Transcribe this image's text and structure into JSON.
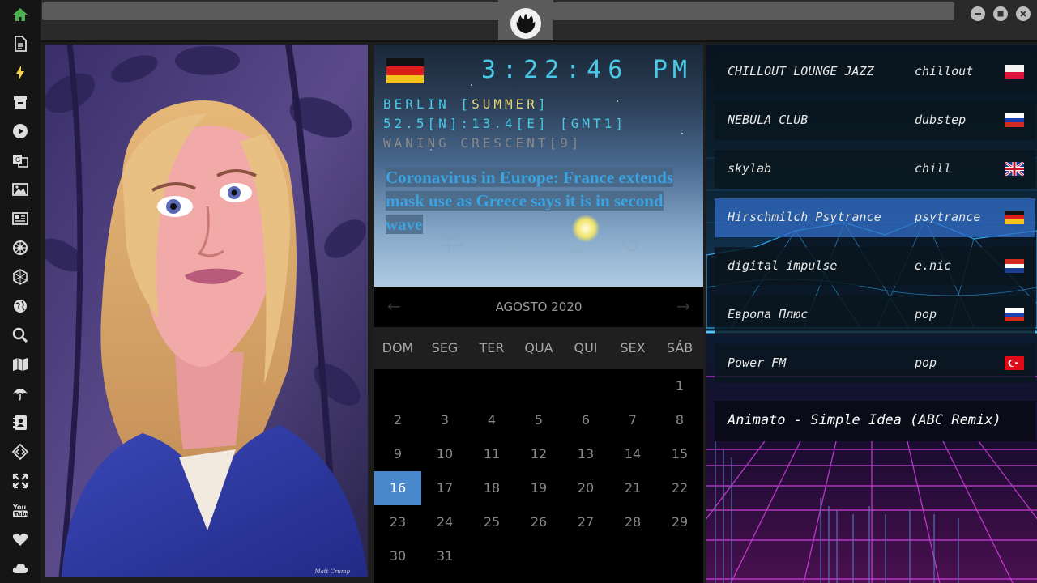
{
  "sidebar": {
    "icons": [
      "home-icon",
      "document-icon",
      "lightning-icon",
      "archive-icon",
      "play-icon",
      "translate-icon",
      "image-icon",
      "news-icon",
      "rebel-icon",
      "empire-icon",
      "globe-icon",
      "search-icon",
      "map-icon",
      "umbrella-icon",
      "contact-card-icon",
      "code-icon",
      "expand-icon",
      "youtube-icon",
      "heart-icon",
      "cloud-icon"
    ],
    "youtube_label": "You Tube"
  },
  "clock": {
    "time": "3:22:46",
    "ampm": "PM",
    "city": "BERLIN",
    "season": "SUMMER",
    "coords": "52.5[N]:13.4[E] [GMT1]",
    "moon": "WANING CRESCENT[9]",
    "news": "Coronavirus in Europe: France extends mask use as Greece says it is in second wave"
  },
  "calendar": {
    "month": "AGOSTO 2020",
    "prev": "←",
    "next": "→",
    "weekdays": [
      "DOM",
      "SEG",
      "TER",
      "QUA",
      "QUI",
      "SEX",
      "SÁB"
    ],
    "today": 16
  },
  "radio": {
    "stations": [
      {
        "name": "CHILLOUT LOUNGE JAZZ",
        "genre": "chillout",
        "flag": "pl"
      },
      {
        "name": "NEBULA CLUB",
        "genre": "dubstep",
        "flag": "ru"
      },
      {
        "name": "skylab",
        "genre": "chill",
        "flag": "gb"
      },
      {
        "name": "Hirschmilch Psytrance",
        "genre": "psytrance",
        "flag": "de"
      },
      {
        "name": "digital impulse",
        "genre": "e.nic",
        "flag": "hr"
      },
      {
        "name": "Европа Плюс",
        "genre": "pop",
        "flag": "ru"
      },
      {
        "name": "Power FM",
        "genre": "pop",
        "flag": "tr"
      }
    ],
    "now_playing": "Animato - Simple Idea (ABC Remix)"
  },
  "portrait": {
    "signature": "Matt Crump"
  },
  "colors": {
    "accent": "#49c9e6",
    "today": "#4a88cc",
    "sidebar_active": "#4caf50"
  }
}
